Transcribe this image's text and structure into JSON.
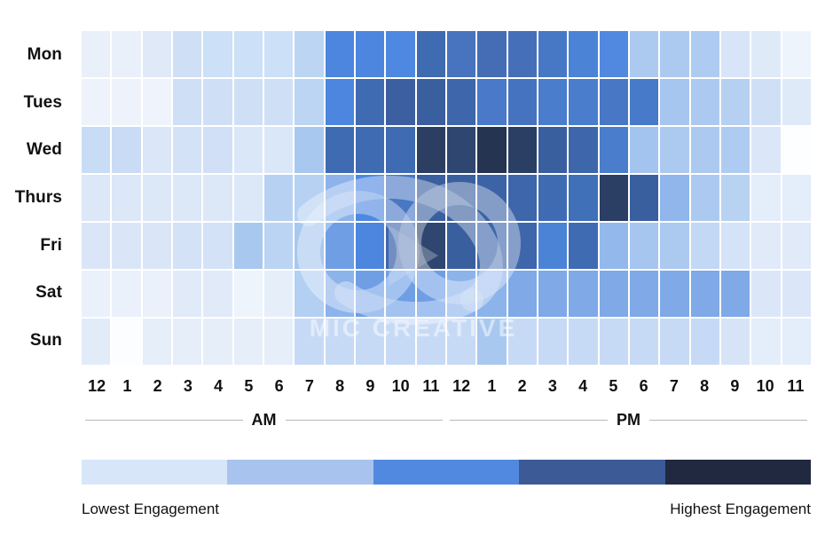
{
  "chart_data": {
    "type": "heatmap",
    "title": "",
    "xlabel": "",
    "ylabel": "",
    "grid": true,
    "legend_position": "bottom",
    "y_categories": [
      "Mon",
      "Tues",
      "Wed",
      "Thurs",
      "Fri",
      "Sat",
      "Sun"
    ],
    "x_categories": [
      "12",
      "1",
      "2",
      "3",
      "4",
      "5",
      "6",
      "7",
      "8",
      "9",
      "10",
      "11",
      "12",
      "1",
      "2",
      "3",
      "4",
      "5",
      "6",
      "7",
      "8",
      "9",
      "10",
      "11"
    ],
    "x_groups": [
      {
        "label": "AM",
        "span": 12
      },
      {
        "label": "PM",
        "span": 12
      }
    ],
    "value_range": [
      0,
      10
    ],
    "colorscale": [
      "#d7e6f9",
      "#a8c4ee",
      "#5189e0",
      "#3c5a96",
      "#20293f"
    ],
    "legend_low_label": "Lowest Engagement",
    "legend_high_label": "Highest Engagement",
    "values": [
      [
        1,
        1,
        2,
        3,
        3,
        3,
        3,
        4,
        7,
        7,
        7,
        8,
        8,
        8,
        8,
        8,
        7,
        7,
        4,
        4,
        4,
        3,
        2,
        1
      ],
      [
        1,
        1,
        1,
        3,
        3,
        3,
        3,
        4,
        7,
        8,
        8,
        8,
        8,
        7,
        7,
        7,
        7,
        7,
        7,
        4,
        4,
        4,
        3,
        2
      ],
      [
        3,
        3,
        2,
        3,
        3,
        2,
        2,
        4,
        8,
        8,
        8,
        9,
        9,
        10,
        10,
        9,
        8,
        8,
        7,
        4,
        4,
        4,
        4,
        2
      ],
      [
        2,
        2,
        2,
        2,
        2,
        2,
        4,
        4,
        5,
        7,
        7,
        8,
        8,
        8,
        8,
        8,
        8,
        10,
        8,
        5,
        4,
        4,
        2,
        2
      ],
      [
        2,
        2,
        2,
        3,
        3,
        4,
        3,
        4,
        6,
        7,
        8,
        9,
        8,
        8,
        8,
        7,
        8,
        5,
        5,
        4,
        4,
        3,
        2,
        2
      ],
      [
        1,
        1,
        1,
        2,
        2,
        1,
        2,
        4,
        5,
        6,
        6,
        6,
        5,
        5,
        5,
        5,
        5,
        5,
        5,
        5,
        5,
        5,
        2,
        2
      ],
      [
        2,
        1,
        2,
        2,
        2,
        2,
        2,
        4,
        4,
        4,
        4,
        4,
        4,
        5,
        4,
        4,
        4,
        4,
        4,
        4,
        4,
        3,
        2,
        2
      ]
    ],
    "cell_colors": [
      [
        "#e9f0fa",
        "#e9f0fa",
        "#dfe9f8",
        "#cfe0f6",
        "#cce0f7",
        "#cce0f7",
        "#cce0f7",
        "#bcd5f3",
        "#4c86df",
        "#4c86df",
        "#4e88e0",
        "#3f6bb3",
        "#4874bf",
        "#446db6",
        "#456fb9",
        "#4778c6",
        "#4b83d7",
        "#5189e0",
        "#accaf0",
        "#accaf0",
        "#aecbf1",
        "#d8e5f8",
        "#dfeaf9",
        "#eef4fc"
      ],
      [
        "#edf2fb",
        "#edf2fb",
        "#eff4fc",
        "#cfe0f6",
        "#cfe0f6",
        "#cfe0f6",
        "#cfe0f6",
        "#bcd5f3",
        "#4c86df",
        "#3f6bb3",
        "#3c5f9f",
        "#3a5f9f",
        "#3e66ab",
        "#4979c8",
        "#4673c0",
        "#4a7dcc",
        "#4a7dcc",
        "#4878c5",
        "#477ac9",
        "#a6c6f0",
        "#accaf0",
        "#b5d0f1",
        "#cfe0f6",
        "#dfeaf9"
      ],
      [
        "#c9dcf5",
        "#cadcf5",
        "#dbe7f8",
        "#d4e2f7",
        "#d1e0f6",
        "#dae7f8",
        "#dae7f8",
        "#a9c8ef",
        "#3f6bb3",
        "#3f6bb3",
        "#3f6bb3",
        "#2c3f63",
        "#2f4670",
        "#243451",
        "#2a3f63",
        "#3a5f9f",
        "#3e66ab",
        "#4a7dcc",
        "#a3c4ef",
        "#accaf0",
        "#accaf0",
        "#aecbf1",
        "#dbe7f8",
        "#fdfeff"
      ],
      [
        "#dce7f8",
        "#dce7f8",
        "#dce7f8",
        "#dce7f8",
        "#dce7f8",
        "#dce7f8",
        "#b6d1f2",
        "#b6d1f2",
        "#8db3ea",
        "#4e88e0",
        "#4877c3",
        "#3a5f9f",
        "#3a5f9f",
        "#3c63a6",
        "#3d66ab",
        "#3f6bb3",
        "#4070b7",
        "#2b3f64",
        "#3a5f9f",
        "#90b6eb",
        "#accaf0",
        "#b8d2f2",
        "#e4edfa",
        "#e4edfa"
      ],
      [
        "#dae6f8",
        "#dae6f8",
        "#dae6f8",
        "#d3e2f7",
        "#d3e2f7",
        "#a9c8ef",
        "#bbd4f3",
        "#a9c8ef",
        "#6f9ee5",
        "#4c86df",
        "#3e66ab",
        "#2f4670",
        "#3a5f9f",
        "#3d66ab",
        "#3e66ab",
        "#4b83d7",
        "#3f6bb3",
        "#93b8ec",
        "#a6c6f0",
        "#accaf0",
        "#c2d8f4",
        "#d4e3f7",
        "#e0eaf9",
        "#e0eaf9"
      ],
      [
        "#eaf1fb",
        "#eaf1fb",
        "#eaf1fb",
        "#e0eaf9",
        "#e0eaf9",
        "#eef4fc",
        "#e6eefa",
        "#b3cff2",
        "#8cb3ea",
        "#6f9ee5",
        "#6f9ee5",
        "#6f9ee5",
        "#8cb3ea",
        "#8cb3ea",
        "#7fa9e7",
        "#7fa9e7",
        "#7fa9e7",
        "#7fa9e7",
        "#7fa9e7",
        "#7fa9e7",
        "#7fa9e7",
        "#7fa9e7",
        "#dbe7f8",
        "#dbe7f8"
      ],
      [
        "#e2ecf9",
        "#fbfdff",
        "#e6eefa",
        "#e6eefa",
        "#e6eefa",
        "#e6eefa",
        "#e6eefa",
        "#c7daf5",
        "#c7daf5",
        "#c7daf5",
        "#c7daf5",
        "#c7daf5",
        "#c7daf5",
        "#a9c8ef",
        "#c7daf5",
        "#c7daf5",
        "#c7daf5",
        "#c7daf5",
        "#c7daf5",
        "#c7daf5",
        "#c7daf5",
        "#d7e4f7",
        "#e4edfa",
        "#e4edfa"
      ]
    ]
  },
  "watermark": {
    "brand_text": "MIC CREATIVE",
    "logo_name": "mic-creative-loop-logo"
  }
}
